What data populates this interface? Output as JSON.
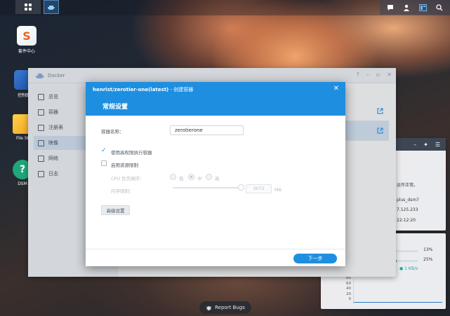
{
  "desktop": {
    "icons": [
      {
        "label": "套件中心",
        "icon": "package-center-icon"
      },
      {
        "label": "控制面",
        "icon": "control-panel-icon"
      },
      {
        "label": "File St",
        "icon": "file-station-icon"
      },
      {
        "label": "DSM",
        "icon": "dsm-help-icon"
      }
    ],
    "report_bugs": "Report Bugs"
  },
  "docker_window": {
    "title": "Docker",
    "sidebar": [
      {
        "label": "总览",
        "icon": "overview-icon"
      },
      {
        "label": "容器",
        "icon": "container-icon"
      },
      {
        "label": "注册表",
        "icon": "registry-icon"
      },
      {
        "label": "映像",
        "icon": "image-icon",
        "active": true
      },
      {
        "label": "网络",
        "icon": "network-icon"
      },
      {
        "label": "日志",
        "icon": "log-icon"
      }
    ]
  },
  "status_widget": {
    "status_text": "运作正常。",
    "hostname": "plus_dsm7",
    "ip": "7.125.233",
    "time": "22:12:20"
  },
  "resource_widget": {
    "cpu_percent": "13%",
    "cpu_value": 0.13,
    "ram_percent": "25%",
    "ram_value": 0.25,
    "network": "1 KB/s",
    "y_ticks": [
      "80",
      "60",
      "40",
      "20",
      "0"
    ],
    "accent": "#2aa89a"
  },
  "dialog": {
    "title_bold": "henrist/zerotier-one(latest)",
    "title_suffix": " - 创建容器",
    "section_title": "常规设置",
    "container_name_label": "容器名称：",
    "container_name_value": "zerotierone",
    "privileged_label": "使用高权限执行容器",
    "privileged_checked": true,
    "resource_limit_label": "启用资源限制",
    "resource_limit_checked": false,
    "cpu_priority_label": "CPU 优先顺序：",
    "cpu_options": [
      "低",
      "中",
      "高"
    ],
    "cpu_selected": "中",
    "memory_limit_label": "内存限制：",
    "memory_value": "3072",
    "memory_unit": "MB",
    "advanced_button": "高级设置",
    "next_button": "下一步",
    "accent_color": "#1e8fe0"
  }
}
